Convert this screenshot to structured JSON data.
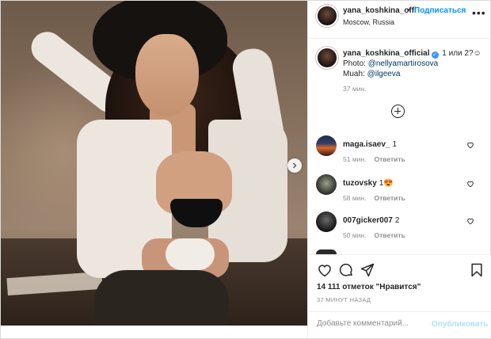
{
  "header": {
    "username": "yana_koshkina_offi",
    "dot": "•",
    "follow_label": "Подписаться",
    "location": "Moscow, Russia",
    "more_label": "•••"
  },
  "caption": {
    "username": "yana_koshkina_official",
    "verified_mark": "✓",
    "text": "1 или 2?☺",
    "photo_prefix": "Photo: ",
    "photo_link": "@nellyamartirosova",
    "muah_prefix": "Muah: ",
    "muah_link": "@ilgeeva",
    "time": "37 мин."
  },
  "comments": [
    {
      "username": "maga.isaev_",
      "text": "1",
      "time": "51 мин.",
      "reply": "Ответить"
    },
    {
      "username": "tuzovsky",
      "text": "1😍",
      "time": "58 мин.",
      "reply": "Ответить"
    },
    {
      "username": "007gicker007",
      "text": "2",
      "time": "50 мин.",
      "reply": "Ответить"
    }
  ],
  "likes": "14 111 отметок \"Нравится\"",
  "posted_ago": "37 МИНУТ НАЗАД",
  "add_comment": {
    "placeholder": "Добавьте комментарий...",
    "publish_label": "Опубликовать"
  },
  "icons": [
    "more-icon",
    "verified-icon",
    "load-more-icon",
    "heart-icon",
    "comment-icon",
    "share-icon",
    "bookmark-icon",
    "chevron-right-icon"
  ],
  "colors": {
    "link": "#00376b",
    "follow": "#0095f6",
    "verified": "#3897f0",
    "publish_disabled": "#b2dffc",
    "meta": "#8e8e8e"
  }
}
